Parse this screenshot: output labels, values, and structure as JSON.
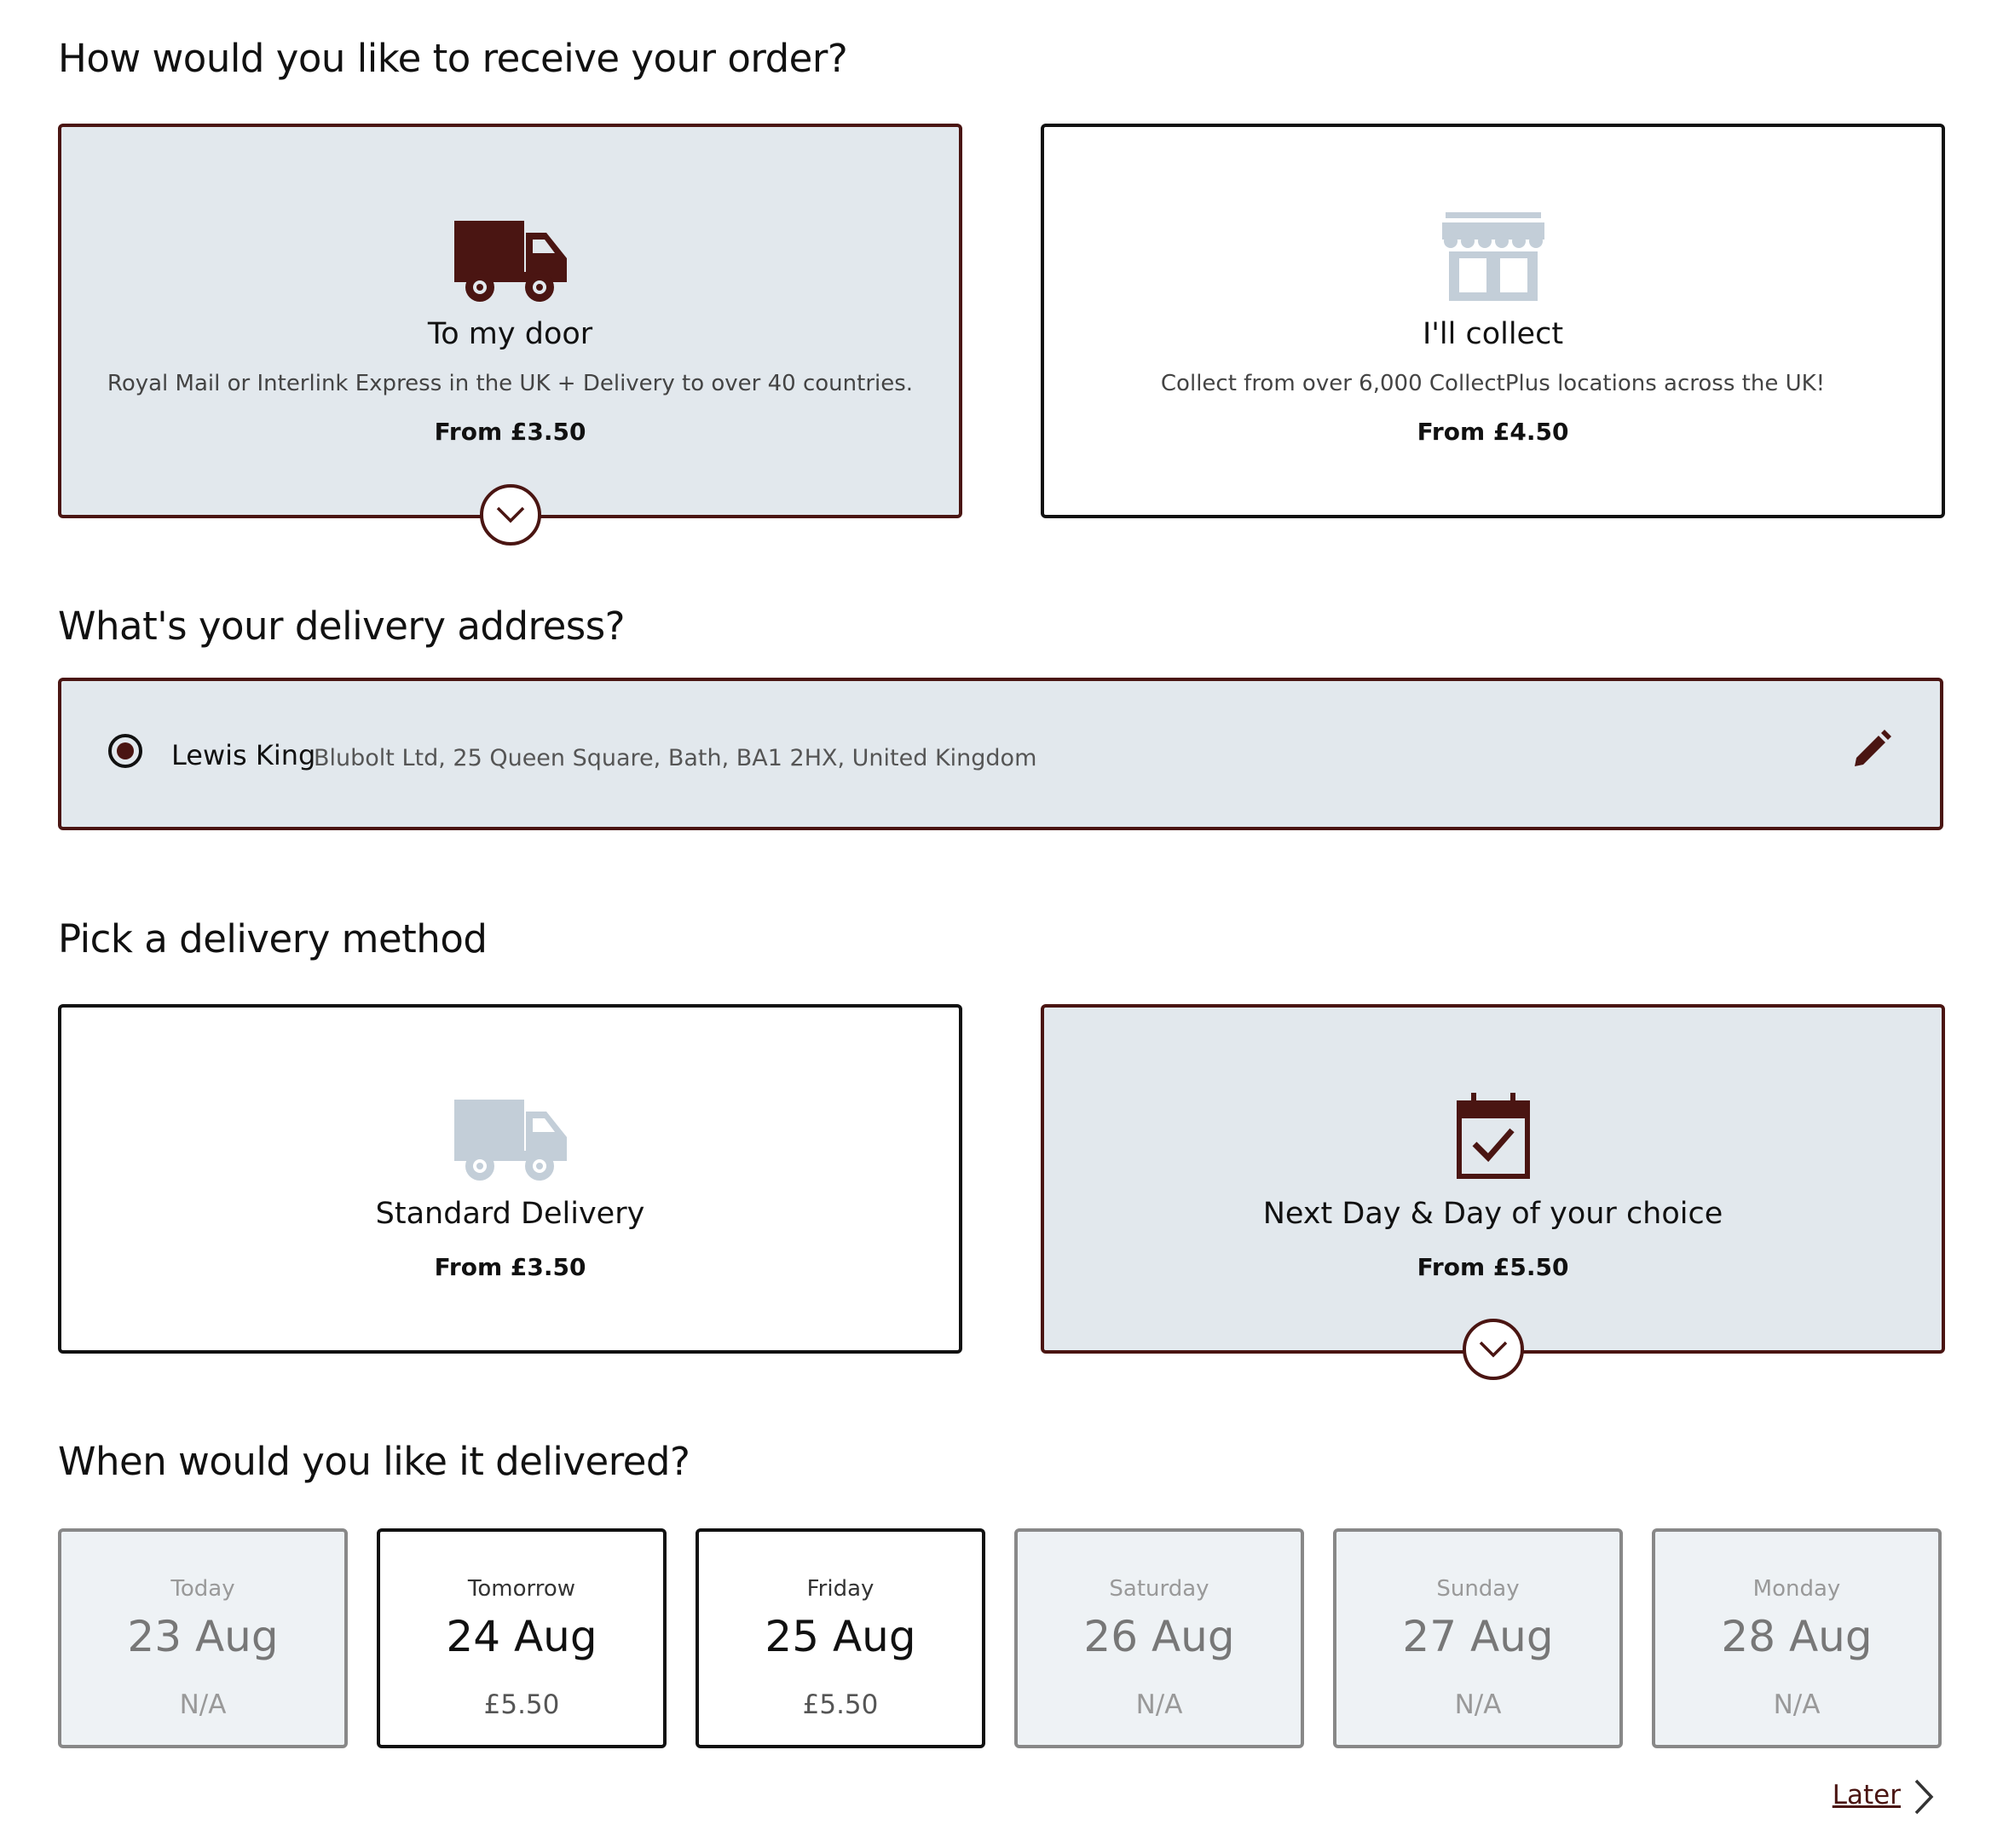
{
  "receive": {
    "heading": "How would you like to receive your order?",
    "options": [
      {
        "title": "To my door",
        "desc": "Royal Mail or Interlink Express in the UK + Delivery to over 40 countries.",
        "price": "From £3.50",
        "icon": "truck-icon",
        "selected": true
      },
      {
        "title": "I'll collect",
        "desc": "Collect from over 6,000 CollectPlus locations across the UK!",
        "price": "From £4.50",
        "icon": "shop-icon",
        "selected": false
      }
    ]
  },
  "address": {
    "heading": "What's your delivery address?",
    "name": "Lewis King",
    "detail": "Blubolt Ltd, 25 Queen Square, Bath, BA1 2HX, United Kingdom"
  },
  "method": {
    "heading": "Pick a delivery method",
    "options": [
      {
        "title": "Standard Delivery",
        "price": "From £3.50",
        "icon": "truck-icon",
        "selected": false
      },
      {
        "title": "Next Day & Day of your choice",
        "price": "From £5.50",
        "icon": "calendar-check-icon",
        "selected": true
      }
    ]
  },
  "when": {
    "heading": "When would you like it delivered?",
    "days": [
      {
        "name": "Today",
        "date": "23 Aug",
        "price": "N/A",
        "available": false
      },
      {
        "name": "Tomorrow",
        "date": "24 Aug",
        "price": "£5.50",
        "available": true
      },
      {
        "name": "Friday",
        "date": "25 Aug",
        "price": "£5.50",
        "available": true
      },
      {
        "name": "Saturday",
        "date": "26 Aug",
        "price": "N/A",
        "available": false
      },
      {
        "name": "Sunday",
        "date": "27 Aug",
        "price": "N/A",
        "available": false
      },
      {
        "name": "Monday",
        "date": "28 Aug",
        "price": "N/A",
        "available": false
      }
    ],
    "later_label": "Later"
  },
  "colors": {
    "accent": "#4a1512",
    "selected_bg": "#e2e8ed",
    "muted_icon": "#c3ced8"
  }
}
